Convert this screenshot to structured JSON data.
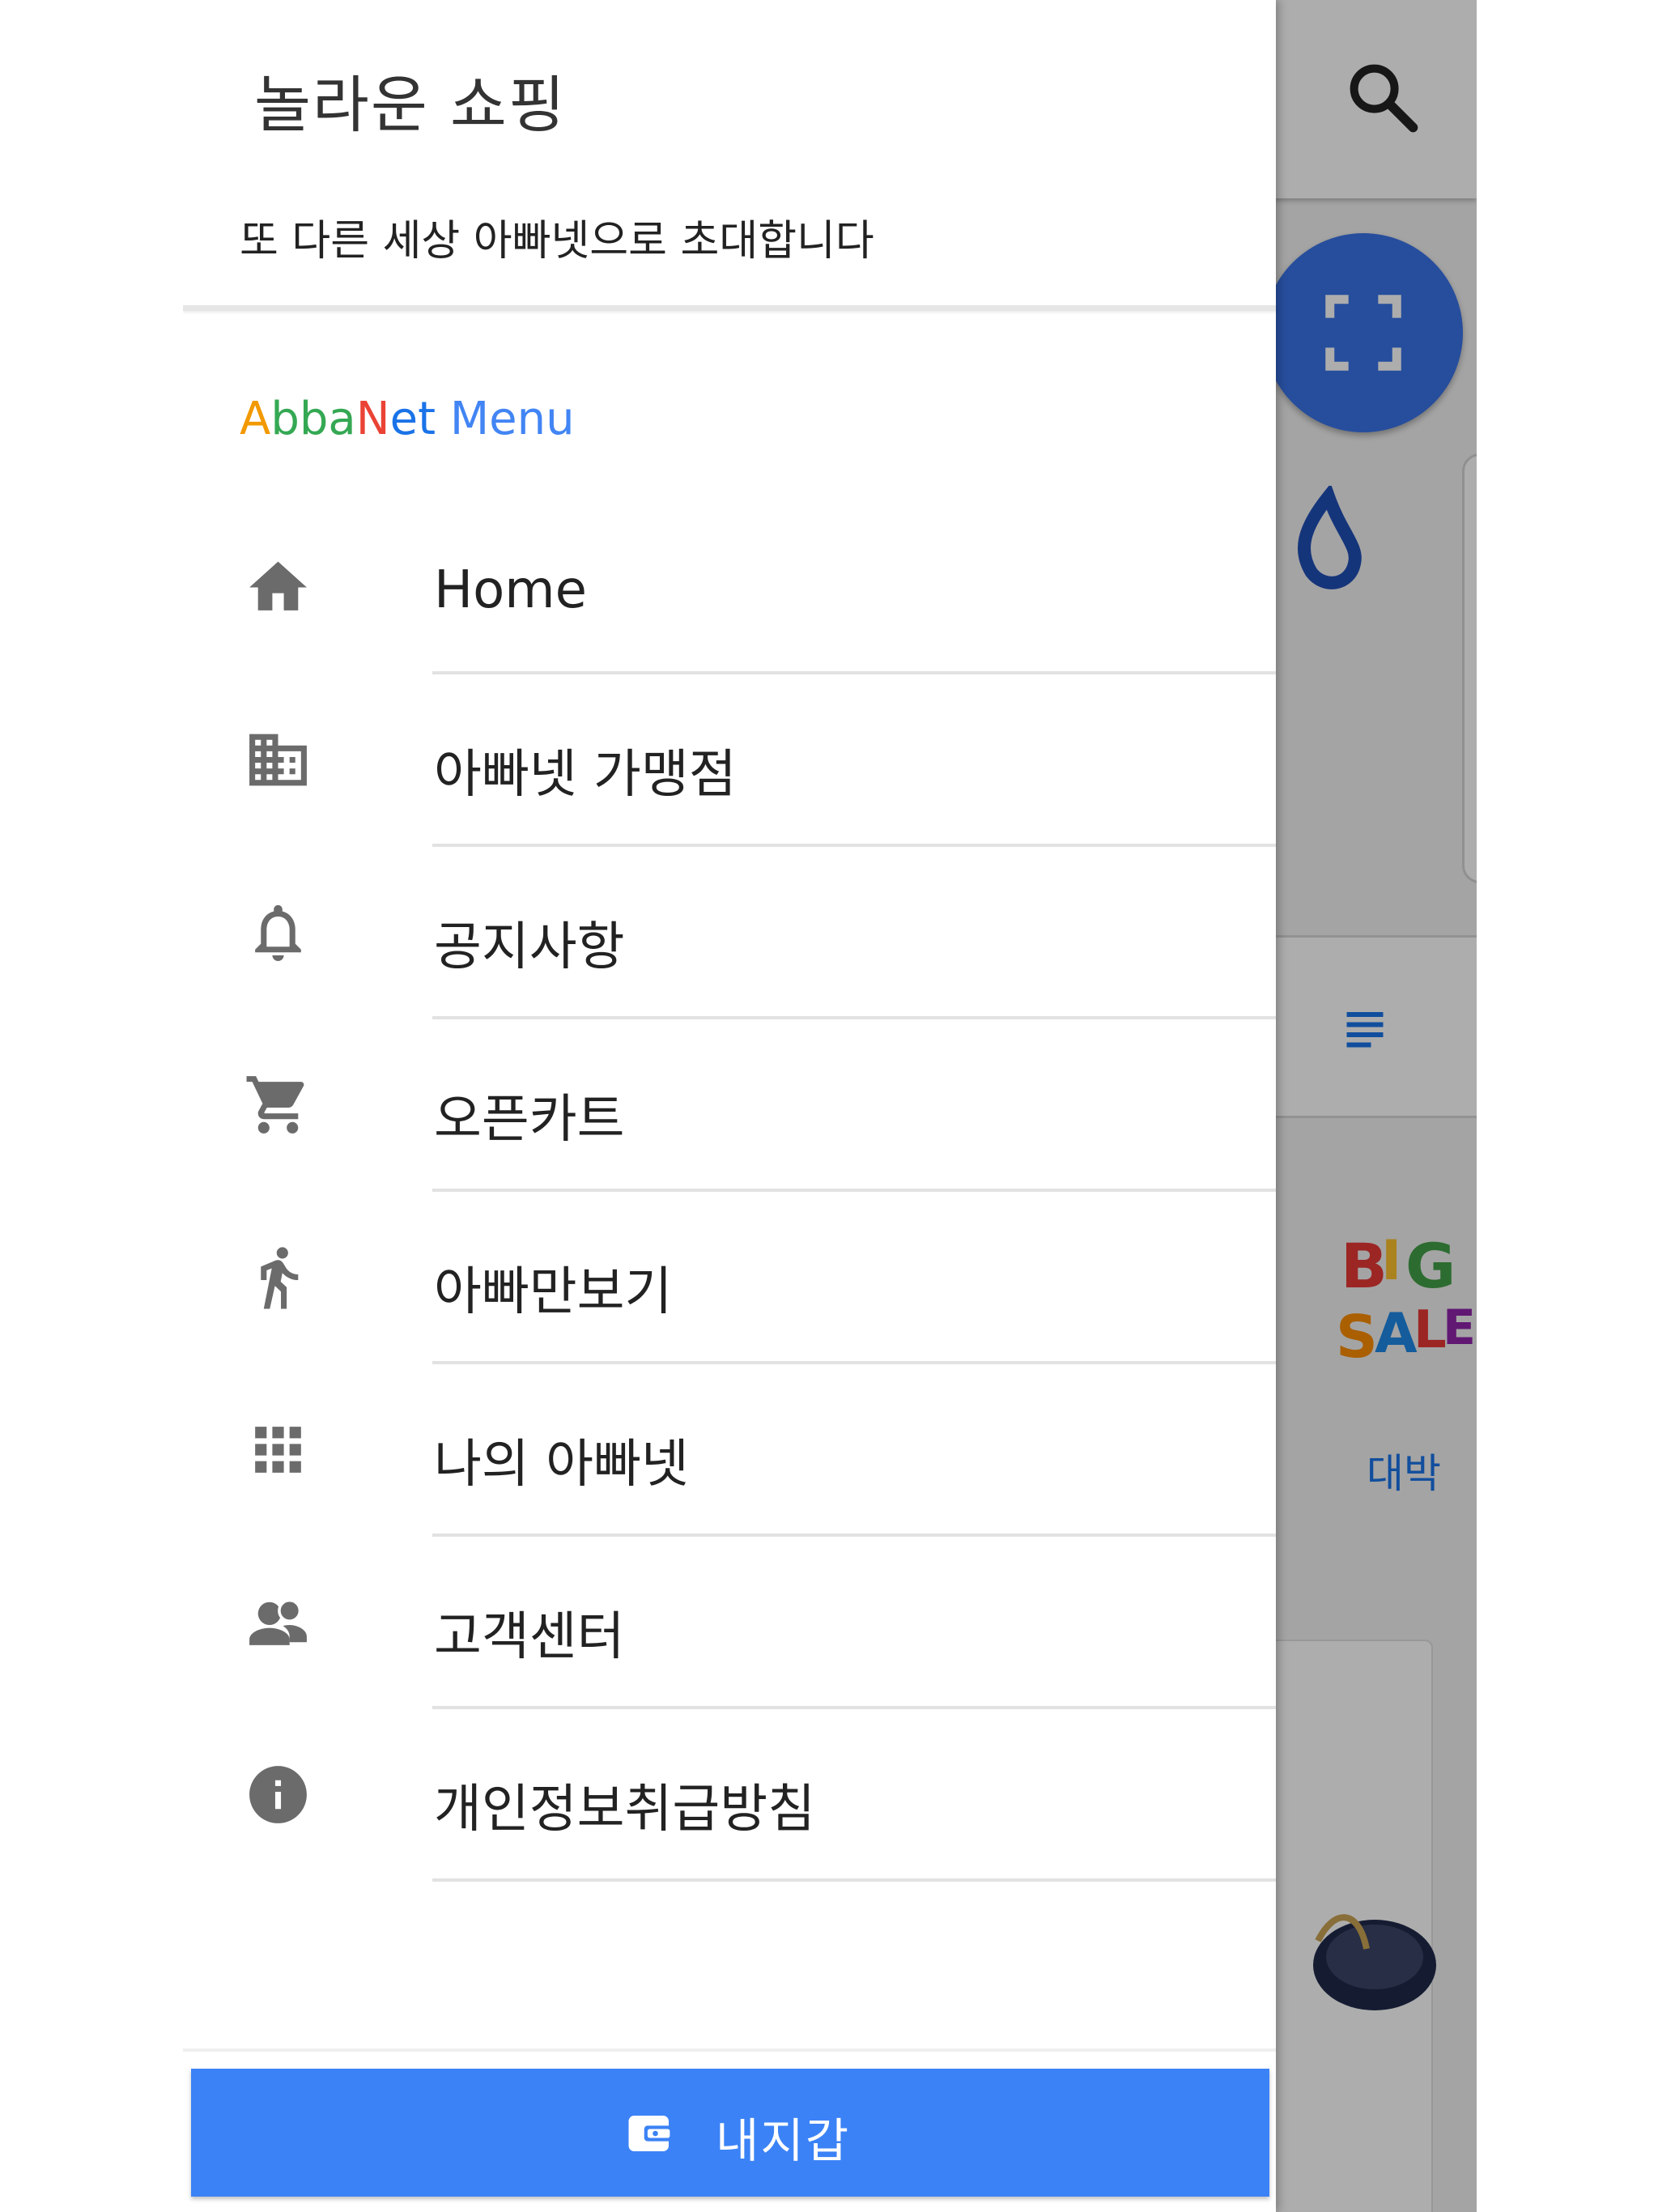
{
  "drawer": {
    "title": "놀라운 쇼핑",
    "subtitle": "또 다른 세상 아빠넷으로 초대합니다",
    "menu_title_parts": [
      {
        "text": "A",
        "color": "#f29900"
      },
      {
        "text": "bba",
        "color": "#34a853"
      },
      {
        "text": "N",
        "color": "#ea4335"
      },
      {
        "text": "et",
        "color": "#1a73e8"
      },
      {
        "text": " Menu",
        "color": "#4285f4"
      }
    ],
    "items": [
      {
        "label": "Home",
        "icon": "home-icon"
      },
      {
        "label": "아빠넷 가맹점",
        "icon": "building-icon"
      },
      {
        "label": "공지사항",
        "icon": "bell-icon"
      },
      {
        "label": "오픈카트",
        "icon": "cart-icon"
      },
      {
        "label": "아빠만보기",
        "icon": "walk-icon"
      },
      {
        "label": "나의 아빠넷",
        "icon": "apps-grid-icon"
      },
      {
        "label": "고객센터",
        "icon": "support-agents-icon"
      },
      {
        "label": "개인정보취급방침",
        "icon": "info-icon"
      }
    ],
    "wallet_button": {
      "label": "내지갑",
      "icon": "wallet-icon",
      "color": "#3b82f6"
    }
  },
  "background": {
    "sale_label": "대박",
    "accent_color": "#3a73e8"
  }
}
